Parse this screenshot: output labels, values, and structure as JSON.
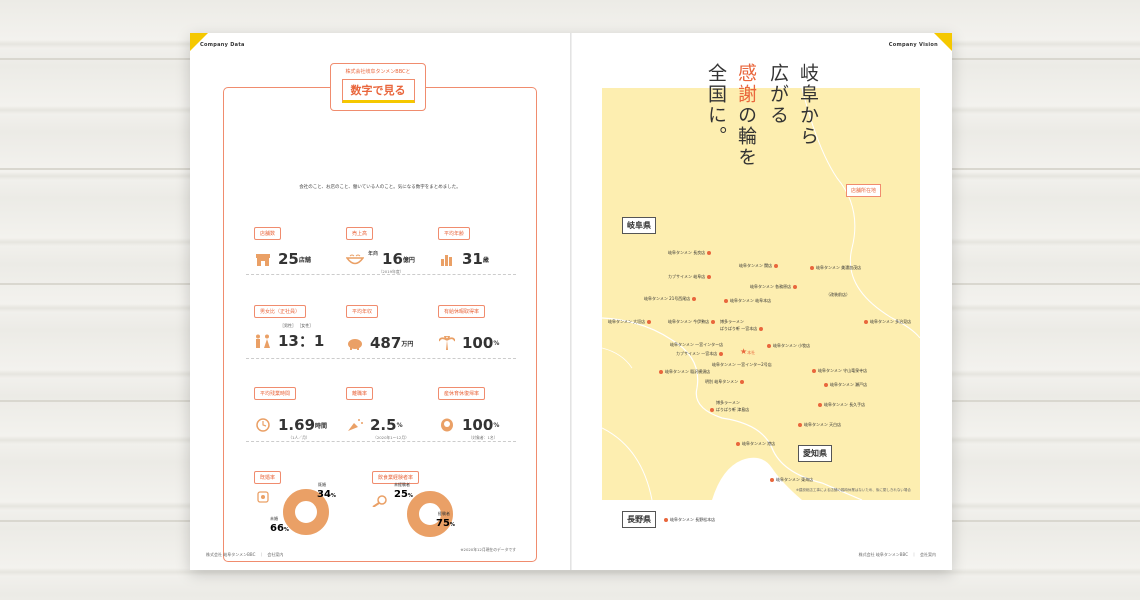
{
  "left_page": {
    "section_label": "Company Data",
    "header_sub": "株式会社岐阜タンメンBBCと",
    "header_main": "数字で見る",
    "intro": "会社のこと、お店のこと、働いている人のこと。気になる数字をまとめました。",
    "stats": [
      {
        "label": "店舗数",
        "value": "25",
        "unit": "店舗",
        "icon": "store-icon"
      },
      {
        "label": "売上高",
        "prefix": "年商",
        "value": "16",
        "unit": "億円",
        "note": "（2019年度）",
        "icon": "bowl-icon"
      },
      {
        "label": "平均年齢",
        "value": "31",
        "unit": "歳",
        "icon": "bar-chart-icon"
      },
      {
        "label": "男女比（正社員）",
        "value": "13：1",
        "prefix_male": "［男性］",
        "prefix_female": "［女性］",
        "icon": "person-icon"
      },
      {
        "label": "平均年収",
        "value": "487",
        "unit": "万円",
        "icon": "piggy-bank-icon"
      },
      {
        "label": "有給休暇取得率",
        "value": "100",
        "unit": "%",
        "icon": "palm-tree-icon"
      },
      {
        "label": "平均残業時間",
        "value": "1.69",
        "unit": "時間",
        "note": "（1人／月）",
        "icon": "clock-icon"
      },
      {
        "label": "離職率",
        "value": "2.5",
        "unit": "%",
        "note": "（2020年1〜12月）",
        "icon": "popper-icon"
      },
      {
        "label": "産休育休復帰率",
        "value": "100",
        "unit": "%",
        "note": "（対象者：1名）",
        "icon": "baby-icon"
      }
    ],
    "marriage": {
      "label": "既婚率",
      "married_label": "既婚",
      "married_value": "34",
      "unmarried_label": "未婚",
      "unmarried_value": "66",
      "unit": "%",
      "icon": "ring-icon"
    },
    "experience": {
      "label": "飲食業経験者率",
      "exp_label": "未経験者",
      "exp_value": "25",
      "inexp_label": "経験者",
      "inexp_value": "75",
      "unit": "%",
      "icon": "magnifier-icon"
    },
    "bottom_note": "※2020年12月現在のデータです",
    "footer": "株式会社 岐阜タンメンBBC　｜　会社案内"
  },
  "right_page": {
    "section_label": "Company Vision",
    "title_lines": [
      {
        "text": "岐阜から",
        "highlight": ""
      },
      {
        "text": "広がる",
        "highlight": ""
      },
      {
        "text": "の輪を",
        "highlight": "感謝"
      },
      {
        "text": "全国に。",
        "highlight": ""
      }
    ],
    "location_tag": "店舗所在地",
    "pref_gifu": "岐阜県",
    "pref_aichi": "愛知県",
    "pref_nagano": "長野県",
    "stores": [
      {
        "name": "岐阜タンメン 長良店"
      },
      {
        "name": "岐阜タンメン 関店"
      },
      {
        "name": "岐阜タンメン 美濃加茂店"
      },
      {
        "name": "カブサイメン 岐阜店"
      },
      {
        "name": "岐阜タンメン 各務原店"
      },
      {
        "name": "（改装前店）"
      },
      {
        "name": "岐阜タンメン 21号西尾店"
      },
      {
        "name": "岐阜タンメン 岐阜本店"
      },
      {
        "name": "岐阜タンメン 大垣店"
      },
      {
        "name": "岐阜タンメン 今伊勢店"
      },
      {
        "name": "博多ラーメン"
      },
      {
        "name": "ばりばり軒 一宮本店"
      },
      {
        "name": "岐阜タンメン 多治見店"
      },
      {
        "name": "岐阜タンメン 一宮インター店"
      },
      {
        "name": "カブサイメン 一宮本店"
      },
      {
        "name": "本社"
      },
      {
        "name": "岐阜タンメン 小牧店"
      },
      {
        "name": "岐阜タンメン 一宮インター2号店"
      },
      {
        "name": "岐阜タンメン 稲沢横須店"
      },
      {
        "name": "岐阜タンメン 守山竜泉寺店"
      },
      {
        "name": "明別 岐阜タンメン"
      },
      {
        "name": "岐阜タンメン 瀬戸店"
      },
      {
        "name": "博多ラーメン"
      },
      {
        "name": "ばりばり軒 津島店"
      },
      {
        "name": "岐阜タンメン 長久手店"
      },
      {
        "name": "岐阜タンメン 天白店"
      },
      {
        "name": "岐阜タンメン 港店"
      },
      {
        "name": "岐阜タンメン 東海店"
      }
    ],
    "nagano_store": "岐阜タンメン 長野松本店",
    "map_note": "※建設総店工事による店舗の臨時休業はないため、後に閉しきれない場合",
    "footer": "株式会社 岐阜タンメンBBC　｜　会社案内"
  },
  "colors": {
    "accent": "#e9663c",
    "yellow": "#f5c800",
    "map": "#fdeeb0",
    "donut": "#eaa066"
  }
}
